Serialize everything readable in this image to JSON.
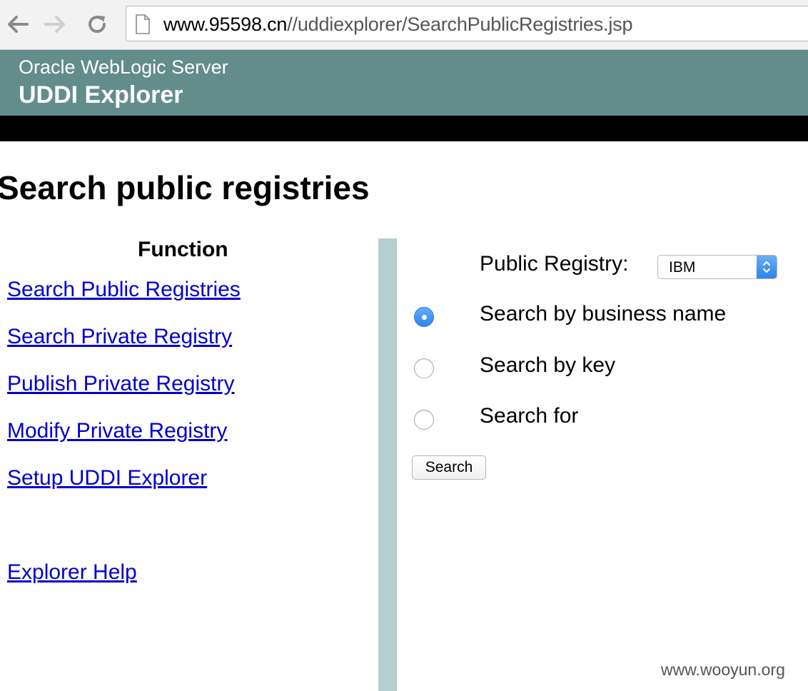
{
  "browser": {
    "url_host": "www.95598.cn",
    "url_path": "//uddiexplorer/SearchPublicRegistries.jsp",
    "icons": [
      "back-arrow-icon",
      "forward-arrow-icon",
      "reload-icon",
      "page-icon"
    ]
  },
  "header": {
    "product": "Oracle WebLogic Server",
    "app": "UDDI Explorer",
    "color": "#628d8a"
  },
  "page": {
    "title": "Search public registries"
  },
  "sidebar": {
    "heading": "Function",
    "links": [
      {
        "label": "Search Public Registries"
      },
      {
        "label": "Search Private Registry"
      },
      {
        "label": "Publish Private Registry"
      },
      {
        "label": "Modify Private Registry"
      },
      {
        "label": "Setup UDDI Explorer"
      }
    ],
    "help_link": "Explorer Help",
    "link_color": "#0000cc"
  },
  "form": {
    "registry_label": "Public Registry:",
    "registry_value": "IBM",
    "options": [
      {
        "label": "Search by business name",
        "selected": true
      },
      {
        "label": "Search by key",
        "selected": false
      },
      {
        "label": "Search for",
        "selected": false
      }
    ],
    "search_button": "Search"
  },
  "watermark": "www.wooyun.org"
}
